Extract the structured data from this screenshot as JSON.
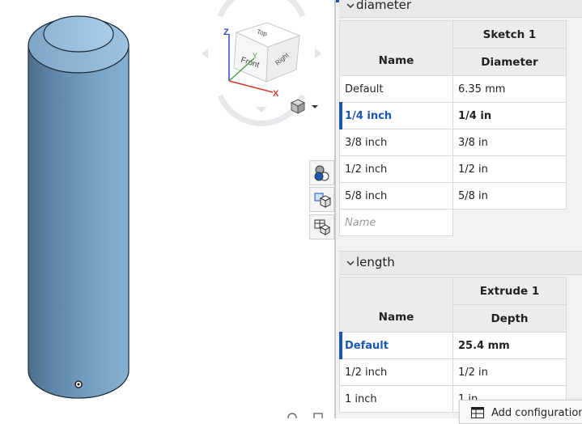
{
  "viewcube": {
    "face_top": "Top",
    "face_front": "Front",
    "face_right": "Right",
    "axis_x": "X",
    "axis_y": "Y",
    "axis_z": "Z"
  },
  "colors": {
    "accent": "#1a56b4",
    "model_body": "#6f99bd",
    "axis_x": "#d23a2a",
    "axis_y": "#3a9a3a",
    "axis_z": "#2a4ac8"
  },
  "panel": {
    "diameter": {
      "section_title": "diameter",
      "feature_header": "Sketch 1",
      "column_name": "Name",
      "column_param": "Diameter",
      "rows": [
        {
          "name": "Default",
          "value": "6.35 mm"
        },
        {
          "name": "1/4 inch",
          "value": "1/4 in"
        },
        {
          "name": "3/8 inch",
          "value": "3/8 in"
        },
        {
          "name": "1/2 inch",
          "value": "1/2 in"
        },
        {
          "name": "5/8 inch",
          "value": "5/8 in"
        }
      ],
      "new_row_placeholder": "Name"
    },
    "length": {
      "section_title": "length",
      "feature_header": "Extrude 1",
      "column_name": "Name",
      "column_param": "Depth",
      "rows": [
        {
          "name": "Default",
          "value": "25.4 mm"
        },
        {
          "name": "1/2 inch",
          "value": "1/2 in"
        },
        {
          "name": "1 inch",
          "value": "1 in"
        }
      ]
    },
    "add_configuration_label": "Add configuration"
  }
}
